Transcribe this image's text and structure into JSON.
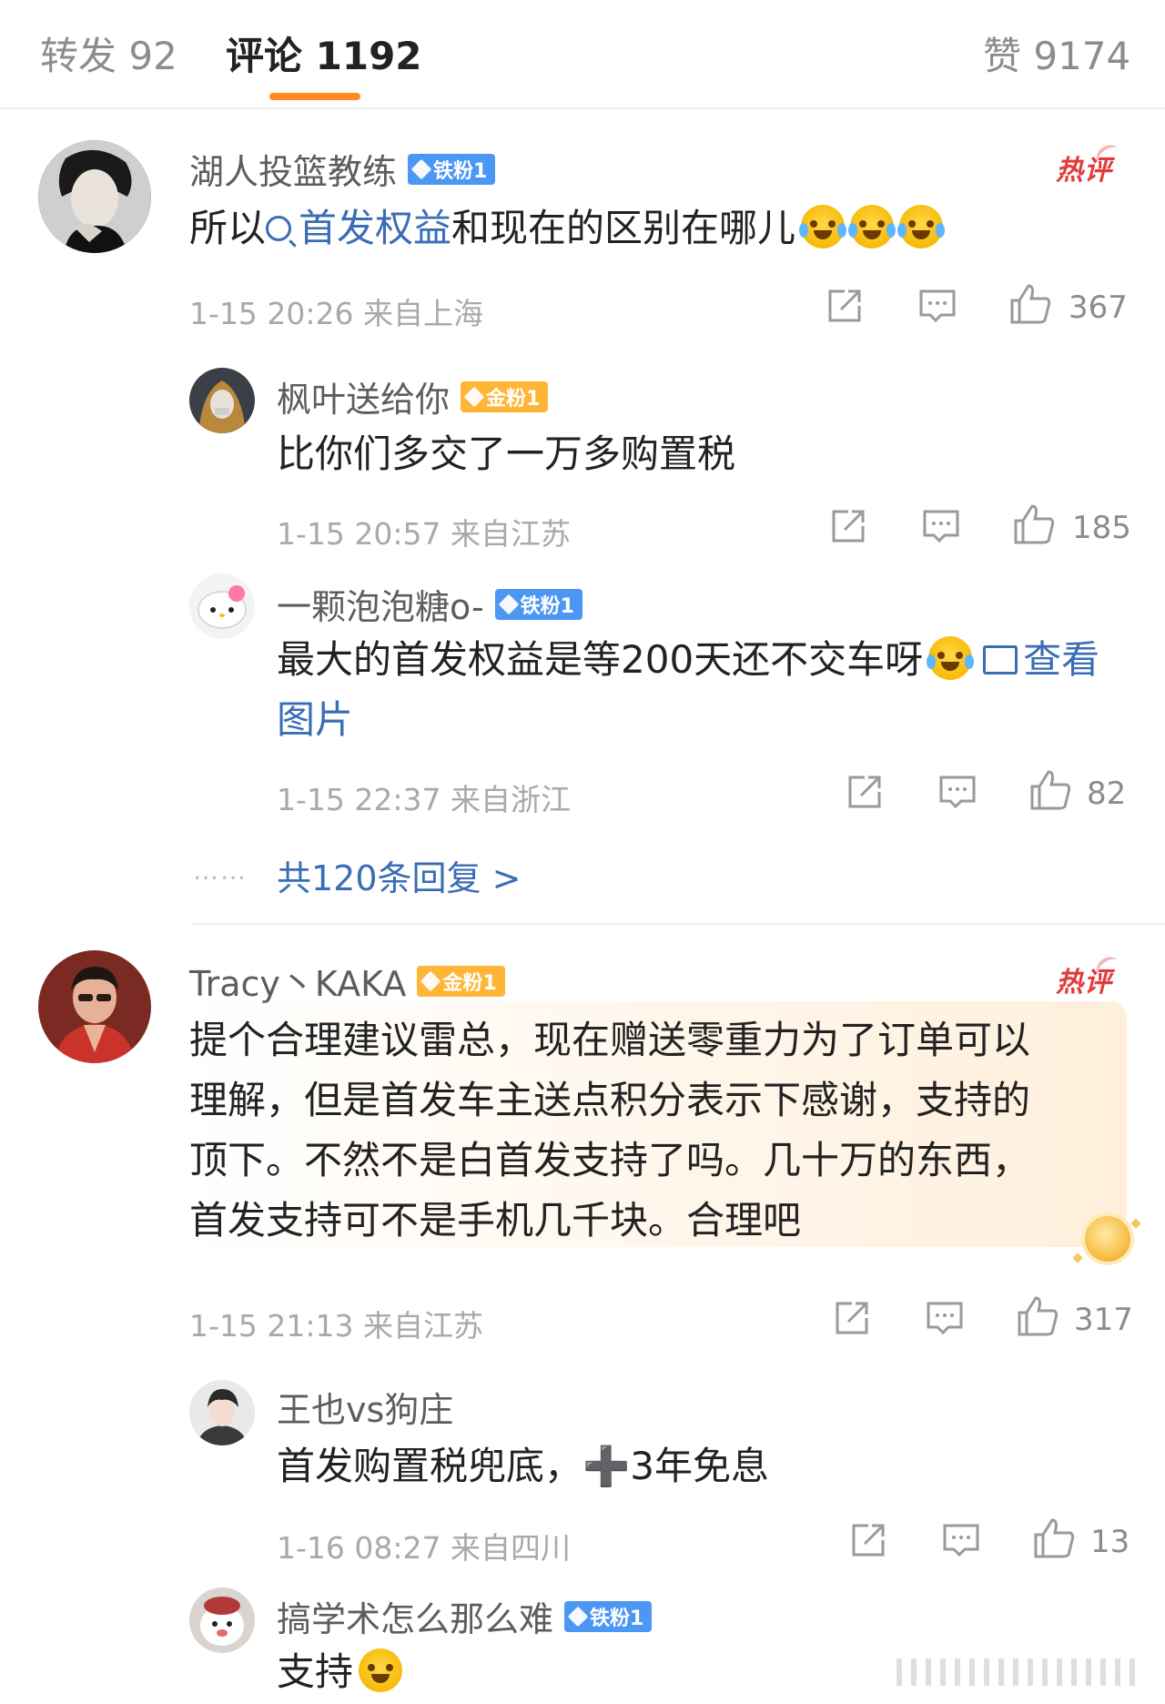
{
  "tabs": {
    "repost": "转发 92",
    "comments": "评论 1192",
    "likes": "赞 9174"
  },
  "colors": {
    "accent": "#ff8a1f",
    "link": "#3a6db4",
    "hot": "#e23b3b",
    "iron_badge": "#4c97f3",
    "gold_badge": "#ffb535"
  },
  "comments": [
    {
      "user": "湖人投篮教练",
      "badge": "铁粉1",
      "hot_label": "热评",
      "text_before": "所以",
      "topic": "首发权益",
      "text_after": "和现在的区别在哪儿",
      "emoji": "laughing-crying-emoji",
      "meta": "1-15 20:26 来自上海",
      "likes": "367",
      "replies": [
        {
          "user": "枫叶送给你",
          "badge": "金粉1",
          "text": "比你们多交了一万多购置税",
          "meta": "1-15 20:57 来自江苏",
          "likes": "185"
        },
        {
          "user": "一颗泡泡糖o-",
          "badge": "铁粉1",
          "text": "最大的首发权益是等200天还不交车呀",
          "image_link": "查看图片",
          "meta": "1-15 22:37 来自浙江",
          "likes": "82"
        }
      ],
      "more_replies": "共120条回复 >",
      "more_dots": "……"
    },
    {
      "user": "Tracy丶KAKA",
      "badge": "金粉1",
      "hot_label": "热评",
      "lines": [
        "提个合理建议雷总，现在赠送零重力为了订单可以",
        "理解，但是首发车主送点积分表示下感谢，支持的",
        "顶下。不然不是白首发支持了吗。几十万的东西，",
        "首发支持可不是手机几千块。合理吧"
      ],
      "meta": "1-15 21:13 来自江苏",
      "likes": "317",
      "replies": [
        {
          "user": "王也vs狗庄",
          "text": "首发购置税兜底，➕3年免息",
          "meta": "1-16 08:27 来自四川",
          "likes": "13"
        },
        {
          "user": "搞学术怎么那么难",
          "badge": "铁粉1",
          "text": "支持"
        }
      ]
    }
  ]
}
